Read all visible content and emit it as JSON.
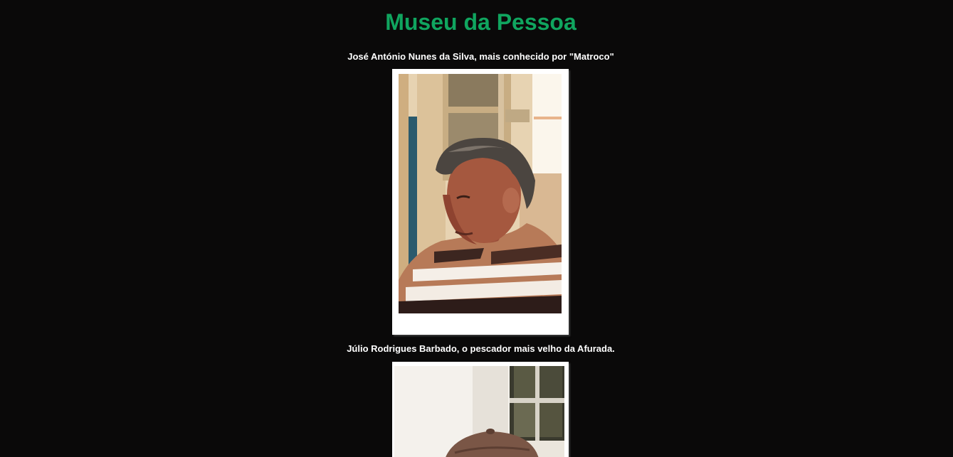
{
  "page": {
    "title": "Museu da Pessoa",
    "title_color": "#10a55f",
    "background_color": "#0a0909"
  },
  "entries": [
    {
      "caption": "José António Nunes da Silva, mais conhecido por \"Matroco\"",
      "photo_subject": "portrait-man-profile-photo"
    },
    {
      "caption": "Júlio Rodrigues Barbado, o pescador mais velho da Afurada.",
      "photo_subject": "portrait-man-with-cap-photo"
    }
  ]
}
